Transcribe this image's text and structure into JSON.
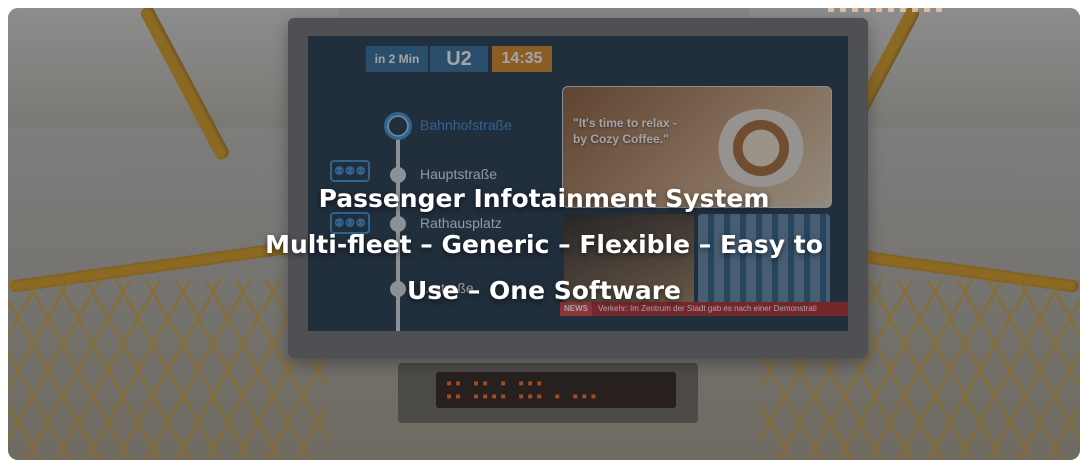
{
  "hero": {
    "title_line1": "Passenger Infotainment System",
    "title_line2": "Multi-fleet – Generic – Flexible – Easy to",
    "title_line3": "Use – One Software"
  },
  "screen": {
    "time_to_arrival": "in 2 Min",
    "line": "U2",
    "clock": "14:35",
    "stops": [
      "Bahnhofstraße",
      "Hauptstraße",
      "Rathausplatz",
      "…straße"
    ],
    "ad_quote": "\"It's time to relax - by Cozy Coffee.\"",
    "news_tag": "NEWS",
    "news_text": "Verkehr: Im Zentrum der Stadt gab es nach einer Demonstrati"
  },
  "colors": {
    "overlay": "#23262d",
    "screen_bg": "#1f3447",
    "accent_blue": "#3b8fd6",
    "accent_orange": "#d8861e",
    "pole_yellow": "#d89a1c"
  }
}
